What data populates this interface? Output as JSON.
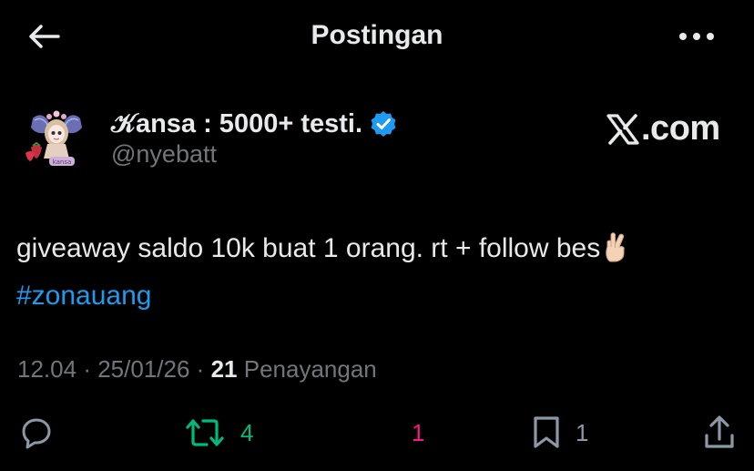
{
  "header": {
    "title": "Postingan",
    "back_icon": "arrow-left-icon",
    "more_icon": "more-horizontal-icon"
  },
  "author": {
    "display_name": "𝒦ansa : 5000+ testi.",
    "handle": "@nyebatt",
    "verified": true,
    "avatar_badge": "kansa"
  },
  "brand": {
    "text": ".com",
    "icon": "x-logo-icon"
  },
  "tweet": {
    "text": "giveaway saldo 10k buat 1 orang. rt + follow bes",
    "emoji": "🤞🏻",
    "hashtag": "#zonauang"
  },
  "meta": {
    "time": "12.04",
    "date": "25/01/26",
    "views_count": "21",
    "views_label": "Penayangan",
    "separator": "·"
  },
  "actions": {
    "reply": {
      "icon": "reply-icon",
      "count": ""
    },
    "repost": {
      "icon": "repost-icon",
      "count": "4"
    },
    "like": {
      "icon": "heart-icon",
      "count": "1"
    },
    "bookmark": {
      "icon": "bookmark-icon",
      "count": "1"
    },
    "share": {
      "icon": "share-icon"
    }
  },
  "colors": {
    "background": "#000000",
    "primary_text": "#e7e9ea",
    "secondary_text": "#71767b",
    "link": "#1d9bf0",
    "verified": "#1d9bf0",
    "repost_active": "#00ba7c",
    "like_active": "#f91880"
  }
}
